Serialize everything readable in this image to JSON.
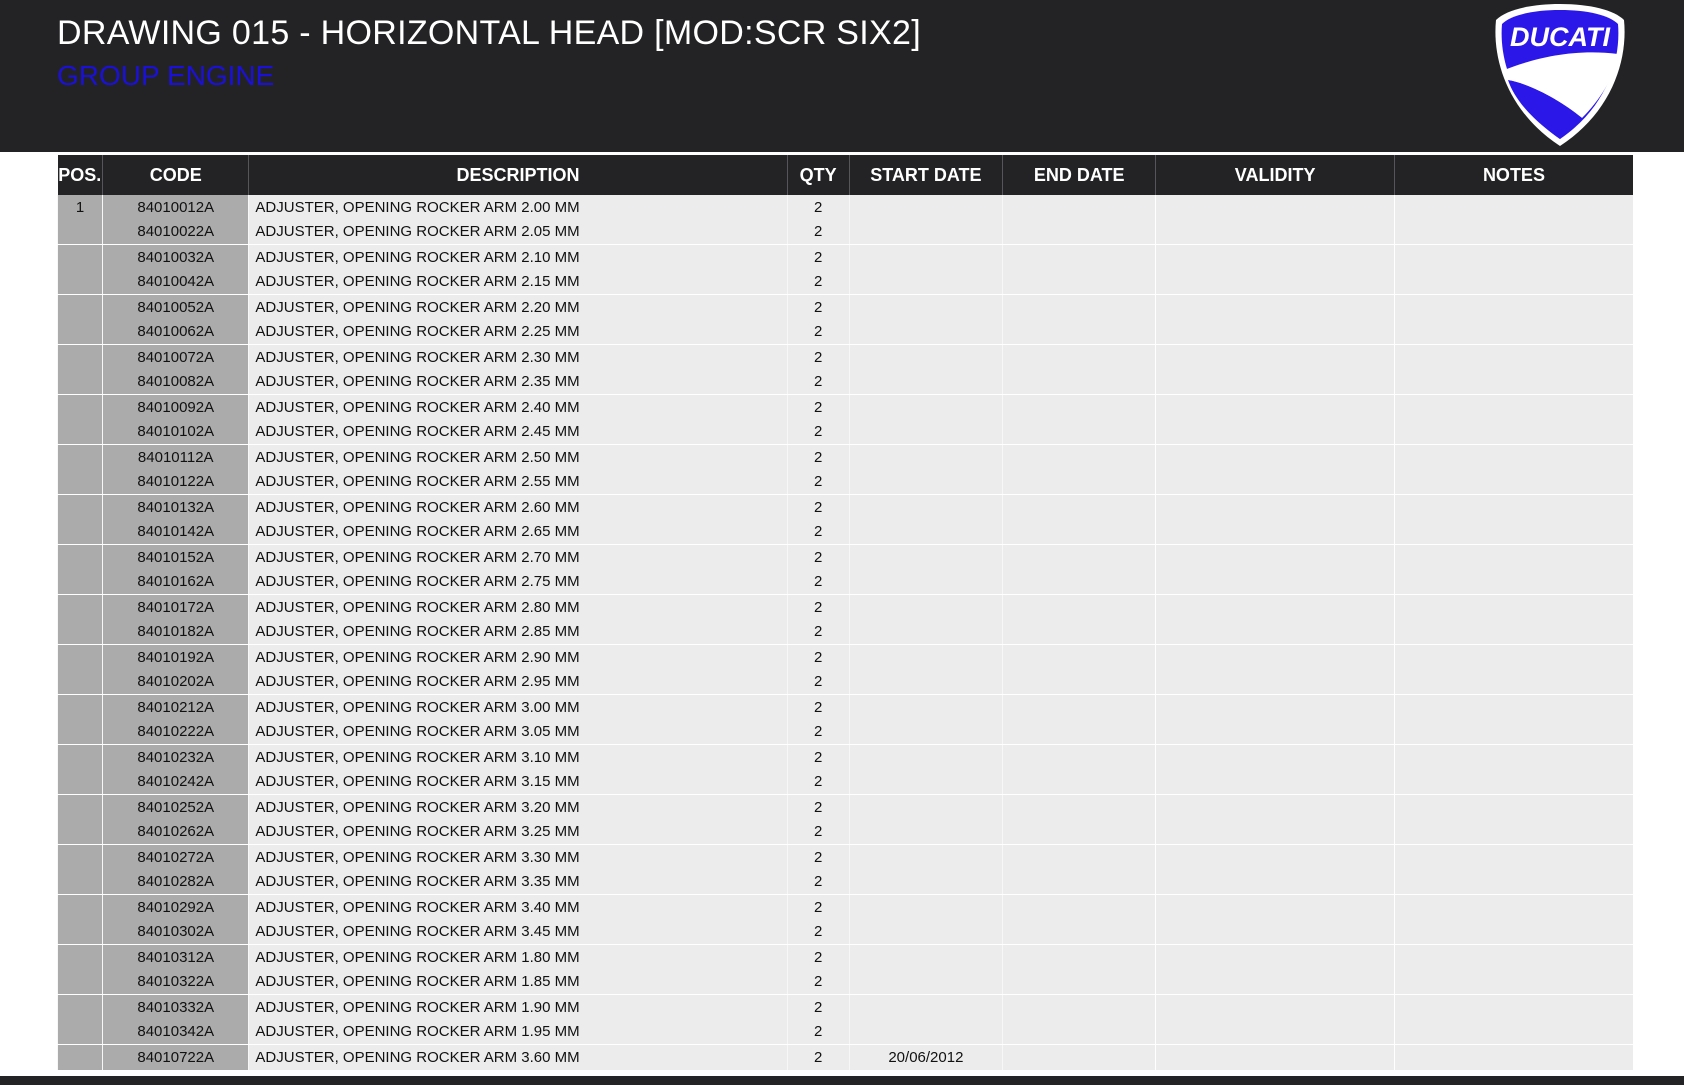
{
  "header": {
    "title": "DRAWING 015 - HORIZONTAL HEAD [MOD:SCR SIX2]",
    "subtitle": "GROUP ENGINE",
    "logo_text": "DUCATI"
  },
  "colors": {
    "header_bg": "#232326",
    "subtitle": "#1a10d8",
    "logo_blue": "#2a17e8",
    "row_bg": "#ececec",
    "code_col_bg": "#ababab"
  },
  "table": {
    "columns": [
      "POS.",
      "CODE",
      "DESCRIPTION",
      "QTY",
      "START DATE",
      "END DATE",
      "VALIDITY",
      "NOTES"
    ],
    "rows": [
      {
        "pos": "1",
        "code": "84010012A",
        "description": "ADJUSTER, OPENING ROCKER ARM 2.00 MM",
        "qty": "2",
        "start_date": "",
        "end_date": "",
        "validity": "",
        "notes": ""
      },
      {
        "pos": "",
        "code": "84010022A",
        "description": "ADJUSTER, OPENING ROCKER ARM 2.05 MM",
        "qty": "2",
        "start_date": "",
        "end_date": "",
        "validity": "",
        "notes": ""
      },
      {
        "pos": "",
        "code": "84010032A",
        "description": "ADJUSTER, OPENING ROCKER ARM 2.10 MM",
        "qty": "2",
        "start_date": "",
        "end_date": "",
        "validity": "",
        "notes": ""
      },
      {
        "pos": "",
        "code": "84010042A",
        "description": "ADJUSTER, OPENING ROCKER ARM 2.15 MM",
        "qty": "2",
        "start_date": "",
        "end_date": "",
        "validity": "",
        "notes": ""
      },
      {
        "pos": "",
        "code": "84010052A",
        "description": "ADJUSTER, OPENING ROCKER ARM 2.20 MM",
        "qty": "2",
        "start_date": "",
        "end_date": "",
        "validity": "",
        "notes": ""
      },
      {
        "pos": "",
        "code": "84010062A",
        "description": "ADJUSTER, OPENING ROCKER ARM 2.25 MM",
        "qty": "2",
        "start_date": "",
        "end_date": "",
        "validity": "",
        "notes": ""
      },
      {
        "pos": "",
        "code": "84010072A",
        "description": "ADJUSTER, OPENING ROCKER ARM 2.30 MM",
        "qty": "2",
        "start_date": "",
        "end_date": "",
        "validity": "",
        "notes": ""
      },
      {
        "pos": "",
        "code": "84010082A",
        "description": "ADJUSTER, OPENING ROCKER ARM 2.35 MM",
        "qty": "2",
        "start_date": "",
        "end_date": "",
        "validity": "",
        "notes": ""
      },
      {
        "pos": "",
        "code": "84010092A",
        "description": "ADJUSTER, OPENING ROCKER ARM 2.40 MM",
        "qty": "2",
        "start_date": "",
        "end_date": "",
        "validity": "",
        "notes": ""
      },
      {
        "pos": "",
        "code": "84010102A",
        "description": "ADJUSTER, OPENING ROCKER ARM 2.45 MM",
        "qty": "2",
        "start_date": "",
        "end_date": "",
        "validity": "",
        "notes": ""
      },
      {
        "pos": "",
        "code": "84010112A",
        "description": "ADJUSTER, OPENING ROCKER ARM 2.50 MM",
        "qty": "2",
        "start_date": "",
        "end_date": "",
        "validity": "",
        "notes": ""
      },
      {
        "pos": "",
        "code": "84010122A",
        "description": "ADJUSTER, OPENING ROCKER ARM 2.55 MM",
        "qty": "2",
        "start_date": "",
        "end_date": "",
        "validity": "",
        "notes": ""
      },
      {
        "pos": "",
        "code": "84010132A",
        "description": "ADJUSTER, OPENING ROCKER ARM 2.60 MM",
        "qty": "2",
        "start_date": "",
        "end_date": "",
        "validity": "",
        "notes": ""
      },
      {
        "pos": "",
        "code": "84010142A",
        "description": "ADJUSTER, OPENING ROCKER ARM 2.65 MM",
        "qty": "2",
        "start_date": "",
        "end_date": "",
        "validity": "",
        "notes": ""
      },
      {
        "pos": "",
        "code": "84010152A",
        "description": "ADJUSTER, OPENING ROCKER ARM 2.70 MM",
        "qty": "2",
        "start_date": "",
        "end_date": "",
        "validity": "",
        "notes": ""
      },
      {
        "pos": "",
        "code": "84010162A",
        "description": "ADJUSTER, OPENING ROCKER ARM 2.75 MM",
        "qty": "2",
        "start_date": "",
        "end_date": "",
        "validity": "",
        "notes": ""
      },
      {
        "pos": "",
        "code": "84010172A",
        "description": "ADJUSTER, OPENING ROCKER ARM 2.80 MM",
        "qty": "2",
        "start_date": "",
        "end_date": "",
        "validity": "",
        "notes": ""
      },
      {
        "pos": "",
        "code": "84010182A",
        "description": "ADJUSTER, OPENING ROCKER ARM 2.85 MM",
        "qty": "2",
        "start_date": "",
        "end_date": "",
        "validity": "",
        "notes": ""
      },
      {
        "pos": "",
        "code": "84010192A",
        "description": "ADJUSTER, OPENING ROCKER ARM 2.90 MM",
        "qty": "2",
        "start_date": "",
        "end_date": "",
        "validity": "",
        "notes": ""
      },
      {
        "pos": "",
        "code": "84010202A",
        "description": "ADJUSTER, OPENING ROCKER ARM 2.95 MM",
        "qty": "2",
        "start_date": "",
        "end_date": "",
        "validity": "",
        "notes": ""
      },
      {
        "pos": "",
        "code": "84010212A",
        "description": "ADJUSTER, OPENING ROCKER ARM 3.00 MM",
        "qty": "2",
        "start_date": "",
        "end_date": "",
        "validity": "",
        "notes": ""
      },
      {
        "pos": "",
        "code": "84010222A",
        "description": "ADJUSTER, OPENING ROCKER ARM 3.05 MM",
        "qty": "2",
        "start_date": "",
        "end_date": "",
        "validity": "",
        "notes": ""
      },
      {
        "pos": "",
        "code": "84010232A",
        "description": "ADJUSTER, OPENING ROCKER ARM 3.10 MM",
        "qty": "2",
        "start_date": "",
        "end_date": "",
        "validity": "",
        "notes": ""
      },
      {
        "pos": "",
        "code": "84010242A",
        "description": "ADJUSTER, OPENING ROCKER ARM 3.15 MM",
        "qty": "2",
        "start_date": "",
        "end_date": "",
        "validity": "",
        "notes": ""
      },
      {
        "pos": "",
        "code": "84010252A",
        "description": "ADJUSTER, OPENING ROCKER ARM 3.20 MM",
        "qty": "2",
        "start_date": "",
        "end_date": "",
        "validity": "",
        "notes": ""
      },
      {
        "pos": "",
        "code": "84010262A",
        "description": "ADJUSTER, OPENING ROCKER ARM 3.25 MM",
        "qty": "2",
        "start_date": "",
        "end_date": "",
        "validity": "",
        "notes": ""
      },
      {
        "pos": "",
        "code": "84010272A",
        "description": "ADJUSTER, OPENING ROCKER ARM 3.30 MM",
        "qty": "2",
        "start_date": "",
        "end_date": "",
        "validity": "",
        "notes": ""
      },
      {
        "pos": "",
        "code": "84010282A",
        "description": "ADJUSTER, OPENING ROCKER ARM 3.35 MM",
        "qty": "2",
        "start_date": "",
        "end_date": "",
        "validity": "",
        "notes": ""
      },
      {
        "pos": "",
        "code": "84010292A",
        "description": "ADJUSTER, OPENING ROCKER ARM 3.40 MM",
        "qty": "2",
        "start_date": "",
        "end_date": "",
        "validity": "",
        "notes": ""
      },
      {
        "pos": "",
        "code": "84010302A",
        "description": "ADJUSTER, OPENING ROCKER ARM 3.45 MM",
        "qty": "2",
        "start_date": "",
        "end_date": "",
        "validity": "",
        "notes": ""
      },
      {
        "pos": "",
        "code": "84010312A",
        "description": "ADJUSTER, OPENING ROCKER ARM 1.80 MM",
        "qty": "2",
        "start_date": "",
        "end_date": "",
        "validity": "",
        "notes": ""
      },
      {
        "pos": "",
        "code": "84010322A",
        "description": "ADJUSTER, OPENING ROCKER ARM 1.85 MM",
        "qty": "2",
        "start_date": "",
        "end_date": "",
        "validity": "",
        "notes": ""
      },
      {
        "pos": "",
        "code": "84010332A",
        "description": "ADJUSTER, OPENING ROCKER ARM 1.90 MM",
        "qty": "2",
        "start_date": "",
        "end_date": "",
        "validity": "",
        "notes": ""
      },
      {
        "pos": "",
        "code": "84010342A",
        "description": "ADJUSTER, OPENING ROCKER ARM 1.95 MM",
        "qty": "2",
        "start_date": "",
        "end_date": "",
        "validity": "",
        "notes": ""
      },
      {
        "pos": "",
        "code": "84010722A",
        "description": "ADJUSTER, OPENING ROCKER ARM 3.60 MM",
        "qty": "2",
        "start_date": "20/06/2012",
        "end_date": "",
        "validity": "",
        "notes": ""
      }
    ]
  }
}
